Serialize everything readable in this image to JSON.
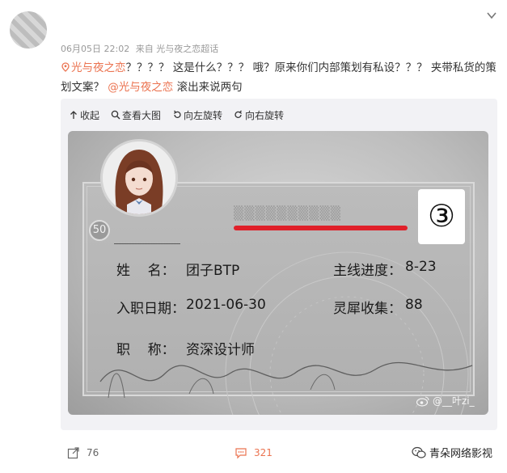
{
  "post": {
    "timestamp": "06月05日 22:02",
    "source_prefix": "来自",
    "source": "光与夜之恋超话",
    "text": {
      "topic": "光与夜之恋",
      "body": "？？？？ 这是什么？？？ 哦？原来你们内部策划有私设？？？ 夹带私货的策划文案？",
      "mention": "@光与夜之恋",
      "tail": " 滚出来说两句"
    }
  },
  "toolbar": {
    "collapse": "收起",
    "view_large": "查看大图",
    "rotate_left": "向左旋转",
    "rotate_right": "向右旋转"
  },
  "card": {
    "level_badge": "50",
    "number_mark": "③",
    "name_label": "姓    名：",
    "name_value": "团子BTP",
    "join_label": "入职日期：",
    "join_value": "2021-06-30",
    "title_label": "职    称：",
    "title_value": "资深设计师",
    "progress_label": "主线进度：",
    "progress_value": "8-23",
    "inspiration_label": "灵犀收集：",
    "inspiration_value": "88",
    "watermark": "@__叶zi_"
  },
  "actions": {
    "repost_count": "76",
    "comment_count": "321"
  },
  "corner_watermark": "青朵网络影视",
  "colors": {
    "accent": "#eb7350",
    "redline": "#e0202a"
  }
}
